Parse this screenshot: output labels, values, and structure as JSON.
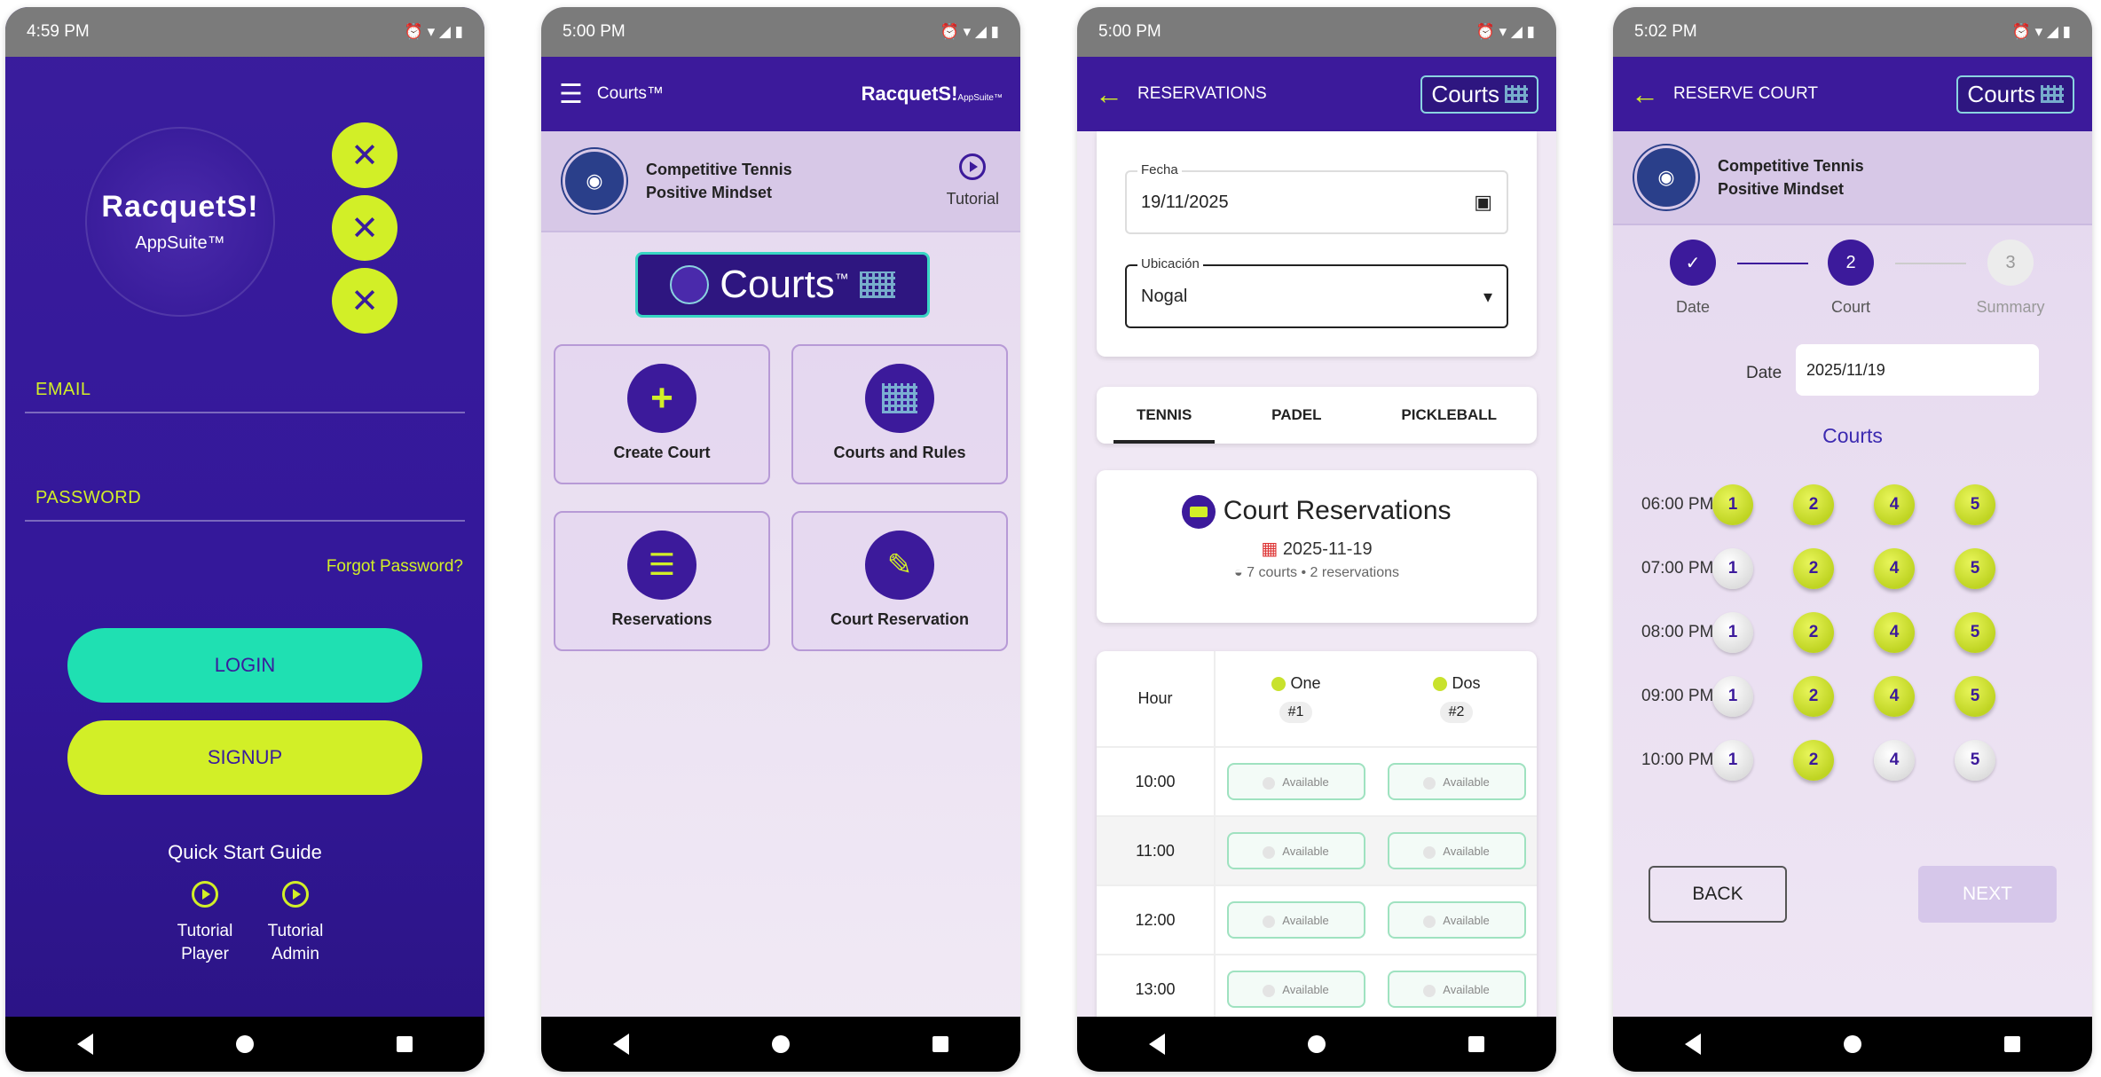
{
  "screens": [
    {
      "time": "4:59 PM"
    },
    {
      "time": "5:00 PM"
    },
    {
      "time": "5:00 PM"
    },
    {
      "time": "5:02 PM"
    }
  ],
  "login": {
    "logo_text": "RacquetS!",
    "logo_sub": "AppSuite™",
    "email_label": "EMAIL",
    "password_label": "PASSWORD",
    "forgot": "Forgot Password?",
    "login_btn": "LOGIN",
    "signup_btn": "SIGNUP",
    "quick_start": "Quick Start Guide",
    "tutorial_player": "Tutorial\nPlayer",
    "tutorial_admin": "Tutorial\nAdmin",
    "colors": {
      "primary": "#3a1d9c",
      "accent_teal": "#1fe0b2",
      "accent_lime": "#d2ef27"
    }
  },
  "home": {
    "appbar_title": "Courts™",
    "brand": "RacquetS!",
    "brand_sub": "AppSuite™",
    "club_line1": "Competitive Tennis",
    "club_line2": "Positive Mindset",
    "tutorial": "Tutorial",
    "banner": "Courts",
    "banner_tm": "™",
    "tiles": [
      {
        "label": "Create Court",
        "icon": "plus-icon"
      },
      {
        "label": "Courts and Rules",
        "icon": "courts-grid-icon"
      },
      {
        "label": "Reservations",
        "icon": "list-icon"
      },
      {
        "label": "Court Reservation",
        "icon": "edit-icon"
      }
    ]
  },
  "reservations": {
    "appbar_title": "RESERVATIONS",
    "logo": "Courts",
    "fecha_label": "Fecha",
    "fecha_value": "19/11/2025",
    "ubicacion_label": "Ubicación",
    "ubicacion_value": "Nogal",
    "tabs": [
      "TENNIS",
      "PADEL",
      "PICKLEBALL"
    ],
    "card_title": "Court Reservations",
    "card_date": "2025-11-19",
    "card_summary": "7 courts • 2 reservations",
    "hour_header": "Hour",
    "courts": [
      {
        "name": "One",
        "num": "#1"
      },
      {
        "name": "Dos",
        "num": "#2"
      }
    ],
    "rows": [
      {
        "hour": "10:00",
        "c1": "Available",
        "c2": "Available"
      },
      {
        "hour": "11:00",
        "c1": "Available",
        "c2": "Available"
      },
      {
        "hour": "12:00",
        "c1": "Available",
        "c2": "Available"
      },
      {
        "hour": "13:00",
        "c1": "Available",
        "c2": "Available"
      }
    ]
  },
  "reserve": {
    "appbar_title": "RESERVE COURT",
    "logo": "Courts",
    "club_line1": "Competitive Tennis",
    "club_line2": "Positive Mindset",
    "steps": [
      {
        "label": "Date",
        "num": "✓"
      },
      {
        "label": "Court",
        "num": "2"
      },
      {
        "label": "Summary",
        "num": "3"
      }
    ],
    "date_label": "Date",
    "date_value": "2025/11/19",
    "courts_heading": "Courts",
    "times": [
      "06:00 PM",
      "07:00 PM",
      "08:00 PM",
      "09:00 PM",
      "10:00 PM"
    ],
    "court_numbers": [
      "1",
      "2",
      "4",
      "5"
    ],
    "availability": [
      [
        true,
        true,
        true,
        true
      ],
      [
        false,
        true,
        true,
        true
      ],
      [
        false,
        true,
        true,
        true
      ],
      [
        false,
        true,
        true,
        true
      ],
      [
        false,
        true,
        false,
        false
      ]
    ],
    "back": "BACK",
    "next": "NEXT"
  }
}
